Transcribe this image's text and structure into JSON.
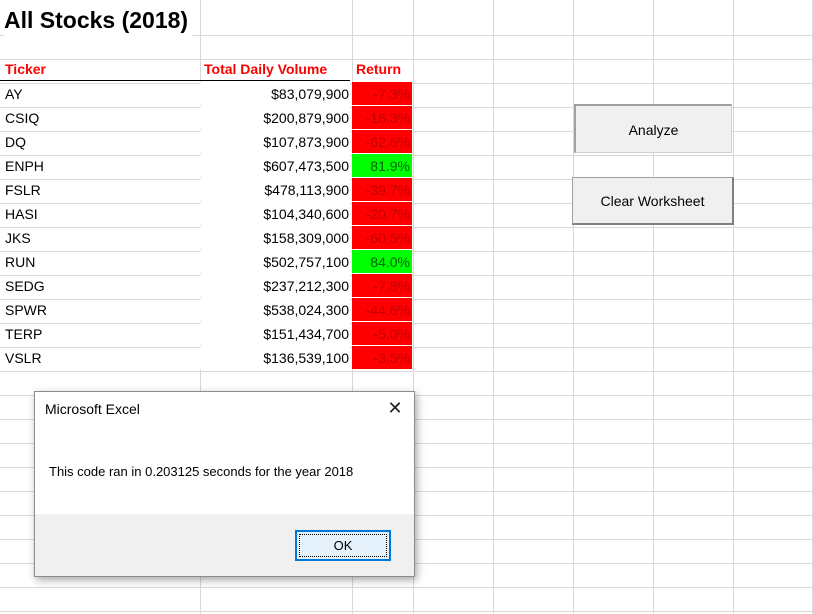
{
  "sheet": {
    "title": "All Stocks (2018)",
    "headers": {
      "ticker": "Ticker",
      "volume": "Total Daily Volume",
      "return": "Return"
    },
    "rows": [
      {
        "ticker": "AY",
        "volume": "$83,079,900",
        "return": "-7.3%",
        "status": "negative"
      },
      {
        "ticker": "CSIQ",
        "volume": "$200,879,900",
        "return": "-16.3%",
        "status": "negative"
      },
      {
        "ticker": "DQ",
        "volume": "$107,873,900",
        "return": "-62.6%",
        "status": "negative"
      },
      {
        "ticker": "ENPH",
        "volume": "$607,473,500",
        "return": "81.9%",
        "status": "positive"
      },
      {
        "ticker": "FSLR",
        "volume": "$478,113,900",
        "return": "-39.7%",
        "status": "negative"
      },
      {
        "ticker": "HASI",
        "volume": "$104,340,600",
        "return": "-20.7%",
        "status": "negative"
      },
      {
        "ticker": "JKS",
        "volume": "$158,309,000",
        "return": "-60.5%",
        "status": "negative"
      },
      {
        "ticker": "RUN",
        "volume": "$502,757,100",
        "return": "84.0%",
        "status": "positive"
      },
      {
        "ticker": "SEDG",
        "volume": "$237,212,300",
        "return": "-7.8%",
        "status": "negative"
      },
      {
        "ticker": "SPWR",
        "volume": "$538,024,300",
        "return": "-44.6%",
        "status": "negative"
      },
      {
        "ticker": "TERP",
        "volume": "$151,434,700",
        "return": "-5.0%",
        "status": "negative"
      },
      {
        "ticker": "VSLR",
        "volume": "$136,539,100",
        "return": "-3.5%",
        "status": "negative"
      }
    ]
  },
  "buttons": {
    "analyze": "Analyze",
    "clear": "Clear Worksheet"
  },
  "dialog": {
    "title": "Microsoft Excel",
    "message": "This code ran in 0.203125 seconds for the year 2018",
    "ok": "OK",
    "close_icon": "close-icon"
  },
  "colors": {
    "negative_fill": "#ff0000",
    "positive_fill": "#00ff00",
    "header_text": "#ff0000"
  }
}
